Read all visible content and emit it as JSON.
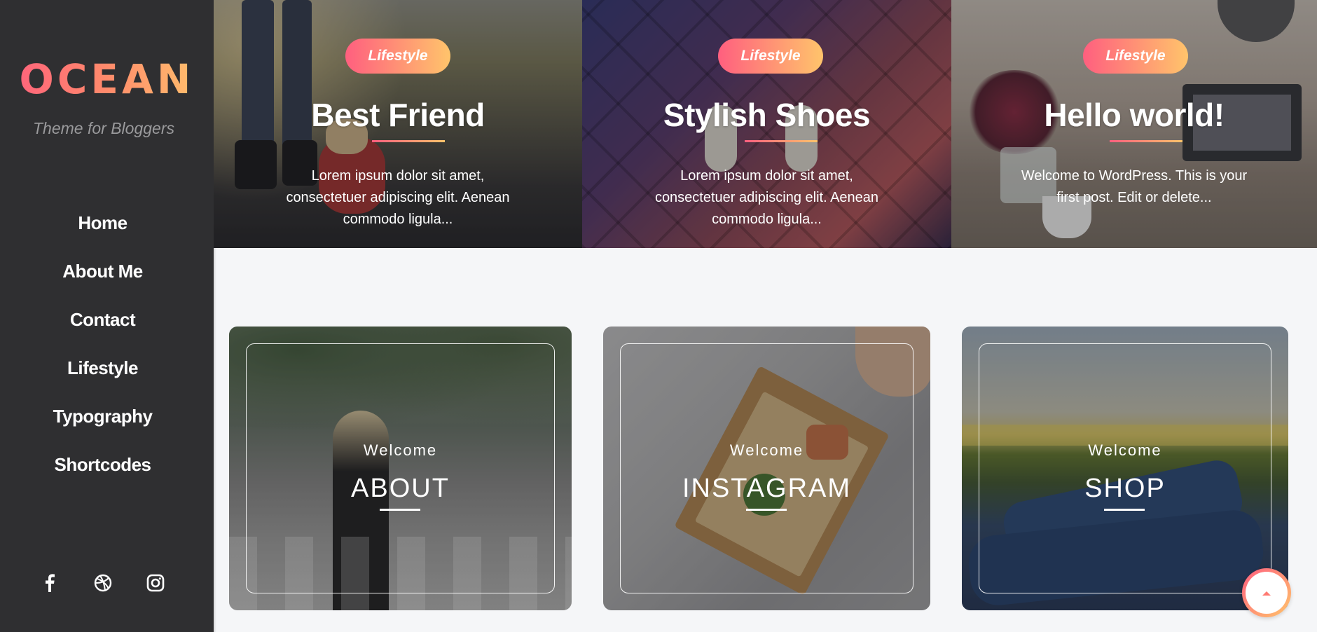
{
  "sidebar": {
    "logo": "OCEAN",
    "tagline": "Theme for Bloggers",
    "nav": [
      "Home",
      "About Me",
      "Contact",
      "Lifestyle",
      "Typography",
      "Shortcodes"
    ],
    "social_icons": [
      "facebook-icon",
      "dribbble-icon",
      "instagram-icon"
    ]
  },
  "slides": [
    {
      "category": "Lifestyle",
      "title": "Best Friend",
      "excerpt_lines": [
        "Lorem ipsum dolor sit amet,",
        "consectetuer adipiscing elit. Aenean",
        "commodo ligula..."
      ]
    },
    {
      "category": "Lifestyle",
      "title": "Stylish Shoes",
      "excerpt_lines": [
        "Lorem ipsum dolor sit amet,",
        "consectetuer adipiscing elit. Aenean",
        "commodo ligula..."
      ]
    },
    {
      "category": "Lifestyle",
      "title": "Hello world!",
      "excerpt_lines": [
        "Welcome to WordPress. This is your",
        "first post. Edit or delete..."
      ]
    }
  ],
  "promo_boxes": [
    {
      "subtitle": "Welcome",
      "title": "ABOUT"
    },
    {
      "subtitle": "Welcome",
      "title": "INSTAGRAM"
    },
    {
      "subtitle": "Welcome",
      "title": "SHOP"
    }
  ],
  "colors": {
    "sidebar_bg": "#2f2f31",
    "accent_start": "#ff5f7f",
    "accent_end": "#ffc46b",
    "page_bg": "#f5f6f8"
  },
  "back_to_top_icon": "arrow-up-icon"
}
